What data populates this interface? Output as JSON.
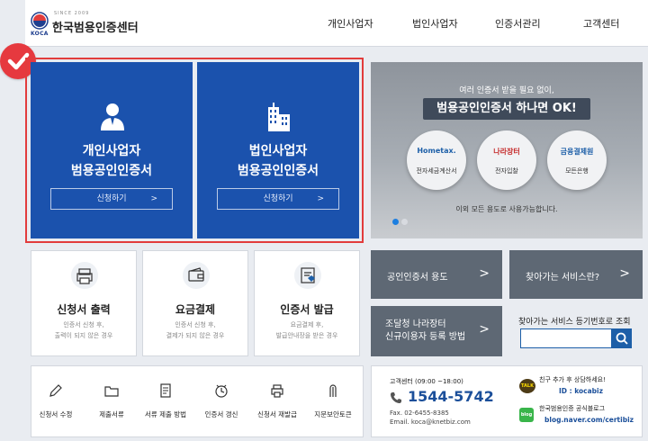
{
  "header": {
    "logo_koca": "KOCA",
    "logo_since": "SINCE 2009",
    "logo_name": "한국범용인증센터",
    "nav": [
      "개인사업자",
      "법인사업자",
      "인증서관리",
      "고객센터"
    ]
  },
  "main_cards": [
    {
      "line1": "개인사업자",
      "line2": "범용공인인증서",
      "button": "신청하기",
      "arrow": ">"
    },
    {
      "line1": "법인사업자",
      "line2": "범용공인인증서",
      "button": "신청하기",
      "arrow": ">"
    }
  ],
  "banner": {
    "subtitle": "여러 인증서 받을 필요 없이,",
    "headline": "범용공인인증서 하나면 OK!",
    "services": [
      {
        "logo": "Hometax.",
        "caption": "전자세금계산서"
      },
      {
        "logo": "나라장터",
        "caption": "전자입찰"
      },
      {
        "logo": "금융결제원",
        "caption": "모든은행"
      }
    ],
    "footer": "이외 모든 용도로 사용가능합니다.",
    "active_slide": 1,
    "slide_count": 2
  },
  "services": [
    {
      "title": "신청서 출력",
      "desc1": "인증서 신청 후,",
      "desc2": "출력이 되지 않은 경우"
    },
    {
      "title": "요금결제",
      "desc1": "인증서 신청 후,",
      "desc2": "결제가 되지 않은 경우"
    },
    {
      "title": "인증서 발급",
      "desc1": "요금결제 후,",
      "desc2": "발급안내장을 받은 경우"
    }
  ],
  "links": {
    "usage": "공인인증서 용도",
    "find_service": "찾아가는 서비스란?",
    "naramarket_line1": "조달청 나라장터",
    "naramarket_line2": "신규이용자 등록 방법",
    "arrow": ">"
  },
  "search": {
    "label": "찾아가는 서비스 등기번호로 조회",
    "placeholder": ""
  },
  "tools": [
    "신청서 수정",
    "제출서류",
    "서류 제출 방법",
    "인증서 갱신",
    "신청서 재발급",
    "지문보안토큰"
  ],
  "contact": {
    "label": "고객센터 (09:00 ~18:00)",
    "phone": "1544-5742",
    "fax": "Fax. 02-6455-8385",
    "email": "Email. koca@knetbiz.com",
    "talk_badge": "TALK",
    "kakao_text": "친구 추가 후 상담하세요!",
    "kakao_id": "ID : kocabiz",
    "blog_badge": "blog",
    "blog_text": "한국범용인증 공식블로그",
    "blog_url": "blog.naver.com/certibiz"
  },
  "colors": {
    "primary_blue": "#1b52ad",
    "highlight_red": "#e23c3c",
    "grey_button": "#5e6874",
    "phone_blue": "#1b4f9a"
  }
}
